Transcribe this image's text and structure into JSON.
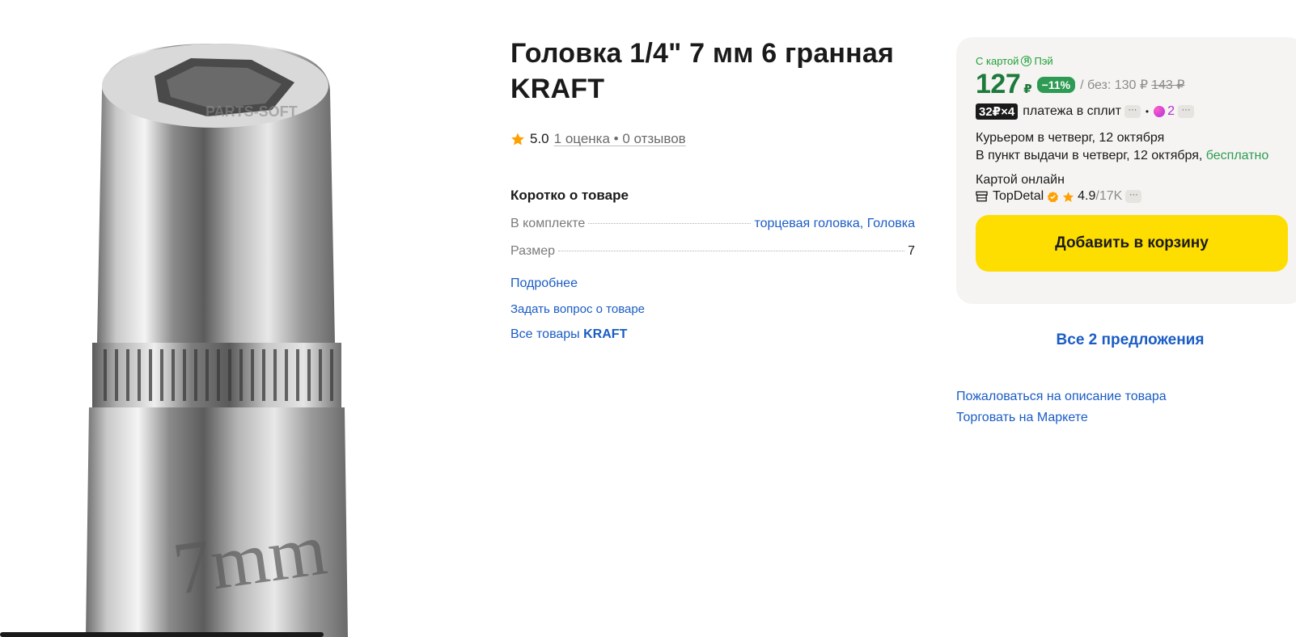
{
  "product": {
    "title": "Головка 1/4\" 7 мм 6 гранная KRAFT",
    "image_watermark": "PARTS-SOFT",
    "image_engraving": "7mm",
    "rating_value": "5.0",
    "rating_link": "1 оценка • 0 отзывов"
  },
  "about": {
    "heading": "Коротко о товаре",
    "specs": [
      {
        "name": "В комплекте",
        "value": "торцевая головка, Головка"
      },
      {
        "name": "Размер",
        "value": "7"
      }
    ],
    "more_link": "Подробнее",
    "ask_link": "Задать вопрос о товаре",
    "brand_link_prefix": "Все товары ",
    "brand_link_brand": "KRAFT"
  },
  "offer": {
    "pay_prefix": "С картой",
    "pay_icon_glyph": "Я",
    "pay_suffix": "Пэй",
    "price": "127",
    "currency": "₽",
    "discount": "−11%",
    "without_label": "/ без: 130 ₽",
    "old_price": "143 ₽",
    "split_badge": "32₽×4",
    "split_label": "платежа в сплит",
    "dots": "···",
    "bullet": "•",
    "plus_count": "2",
    "delivery_courier": "Курьером в четверг, 12 октября",
    "delivery_pickup": "В пункт выдачи в четверг, 12 октября,",
    "delivery_free": "бесплатно",
    "payment": "Картой онлайн",
    "seller_name": "TopDetal",
    "seller_rating": "4.9",
    "seller_count": "/17K",
    "add_to_cart": "Добавить в корзину",
    "accent_color": "#fedd00",
    "price_color": "#1d7a3c"
  },
  "links": {
    "all_offers": "Все 2 предложения",
    "report": "Пожаловаться на описание товара",
    "sell": "Торговать на Маркете"
  }
}
